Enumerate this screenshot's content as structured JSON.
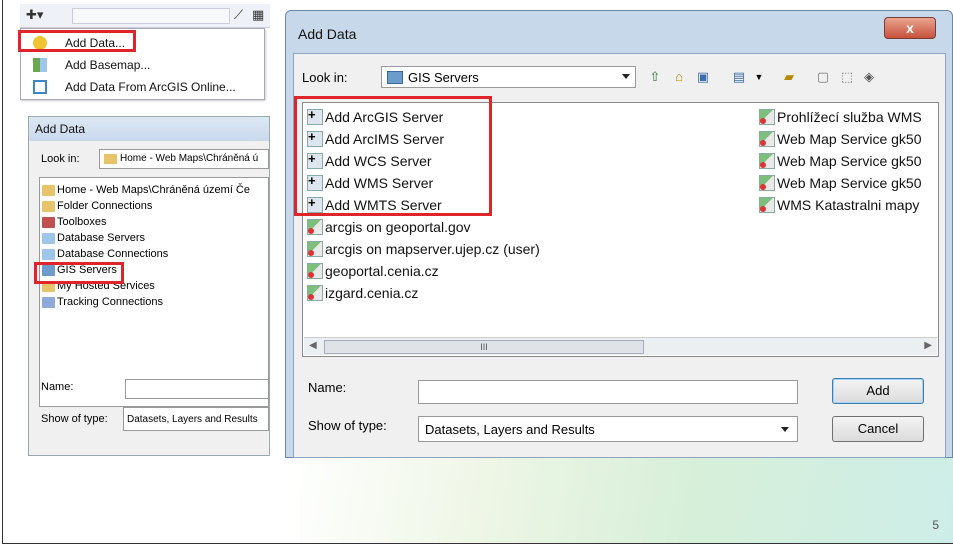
{
  "slide": {
    "page_number": "5"
  },
  "menu": {
    "items": [
      {
        "label": "Add Data...",
        "icon": "add-data-icon"
      },
      {
        "label": "Add Basemap...",
        "icon": "basemap-icon"
      },
      {
        "label": "Add Data From ArcGIS Online...",
        "icon": "arcgis-online-icon"
      }
    ]
  },
  "small_dialog": {
    "title": "Add Data",
    "look_in_label": "Look in:",
    "look_in_value": "Home - Web Maps\\Chráněná ú",
    "items": [
      "Home - Web Maps\\Chráněná území Če",
      "Folder Connections",
      "Toolboxes",
      "Database Servers",
      "Database Connections",
      "GIS Servers",
      "My Hosted Services",
      "Tracking Connections"
    ],
    "name_label": "Name:",
    "type_label": "Show of type:",
    "type_value": "Datasets, Layers and Results"
  },
  "dialog": {
    "title": "Add Data",
    "close_label": "x",
    "look_in_label": "Look in:",
    "look_in_value": "GIS Servers",
    "left_items": [
      "Add ArcGIS Server",
      "Add ArcIMS Server",
      "Add WCS Server",
      "Add WMS Server",
      "Add WMTS Server",
      "arcgis on geoportal.gov",
      "arcgis on mapserver.ujep.cz (user)",
      "geoportal.cenia.cz",
      "izgard.cenia.cz"
    ],
    "right_items": [
      "Prohlížecí služba WMS",
      "Web Map Service gk50",
      "Web Map Service gk50",
      "Web Map Service gk50",
      "WMS Katastralni mapy"
    ],
    "scroll_label": "III",
    "name_label": "Name:",
    "type_label": "Show of type:",
    "type_value": "Datasets, Layers and Results",
    "add_label": "Add",
    "cancel_label": "Cancel"
  },
  "colors": {
    "highlight": "#e0242b"
  }
}
